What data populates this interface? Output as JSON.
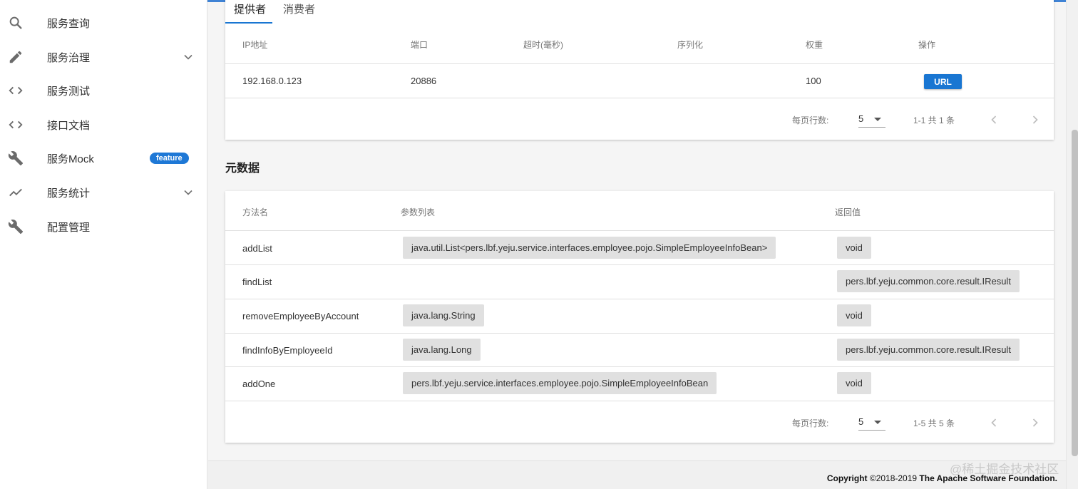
{
  "sidebar": {
    "items": [
      {
        "label": "服务查询",
        "icon": "search-icon"
      },
      {
        "label": "服务治理",
        "icon": "pencil-icon",
        "expandable": true
      },
      {
        "label": "服务测试",
        "icon": "code-icon"
      },
      {
        "label": "接口文档",
        "icon": "code-icon"
      },
      {
        "label": "服务Mock",
        "icon": "wrench-icon",
        "badge": "feature"
      },
      {
        "label": "服务统计",
        "icon": "trending-icon",
        "expandable": true
      },
      {
        "label": "配置管理",
        "icon": "wrench-icon"
      }
    ]
  },
  "tabs": [
    {
      "label": "提供者",
      "active": true
    },
    {
      "label": "消费者",
      "active": false
    }
  ],
  "providers": {
    "headers": [
      "IP地址",
      "端口",
      "超时(毫秒)",
      "序列化",
      "权重",
      "操作"
    ],
    "rows": [
      {
        "ip": "192.168.0.123",
        "port": "20886",
        "timeout": "",
        "serialization": "",
        "weight": "100",
        "action": "URL"
      }
    ],
    "pagination": {
      "rows_per_page_label": "每页行数:",
      "rows_per_page": "5",
      "range": "1-1 共 1 条"
    }
  },
  "metadata": {
    "title": "元数据",
    "headers": [
      "方法名",
      "参数列表",
      "返回值"
    ],
    "rows": [
      {
        "method": "addList",
        "params": [
          "java.util.List<pers.lbf.yeju.service.interfaces.employee.pojo.SimpleEmployeeInfoBean>"
        ],
        "returns": "void"
      },
      {
        "method": "findList",
        "params": [],
        "returns": "pers.lbf.yeju.common.core.result.IResult"
      },
      {
        "method": "removeEmployeeByAccount",
        "params": [
          "java.lang.String"
        ],
        "returns": "void"
      },
      {
        "method": "findInfoByEmployeeId",
        "params": [
          "java.lang.Long"
        ],
        "returns": "pers.lbf.yeju.common.core.result.IResult"
      },
      {
        "method": "addOne",
        "params": [
          "pers.lbf.yeju.service.interfaces.employee.pojo.SimpleEmployeeInfoBean"
        ],
        "returns": "void"
      }
    ],
    "pagination": {
      "rows_per_page_label": "每页行数:",
      "rows_per_page": "5",
      "range": "1-5 共 5 条"
    }
  },
  "footer": {
    "copyright_prefix": "Copyright",
    "copyright_years": " ©2018-2019 ",
    "copyright_org": "The Apache Software Foundation."
  },
  "watermark": "@稀土掘金技术社区",
  "colors": {
    "accent": "#1976d2",
    "badge": "#1e78d6",
    "chip": "#e0e0e0"
  }
}
